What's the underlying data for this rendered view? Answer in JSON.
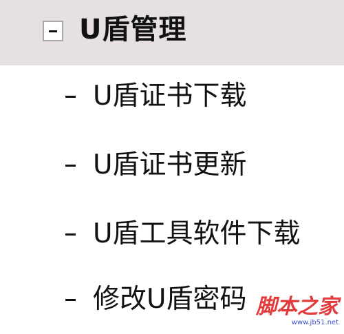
{
  "menu": {
    "title": "U盾管理",
    "items": [
      {
        "label": "U盾证书下载"
      },
      {
        "label": "U盾证书更新"
      },
      {
        "label": "U盾工具软件下载"
      },
      {
        "label": "修改U盾密码"
      }
    ]
  },
  "watermark": {
    "main": "脚本之家",
    "sub": "www.jb51.net"
  },
  "colors": {
    "header_background": "#e6e0e0",
    "text": "#111111",
    "watermark_main": "#e23b3b",
    "watermark_sub": "#3a4fd0"
  }
}
